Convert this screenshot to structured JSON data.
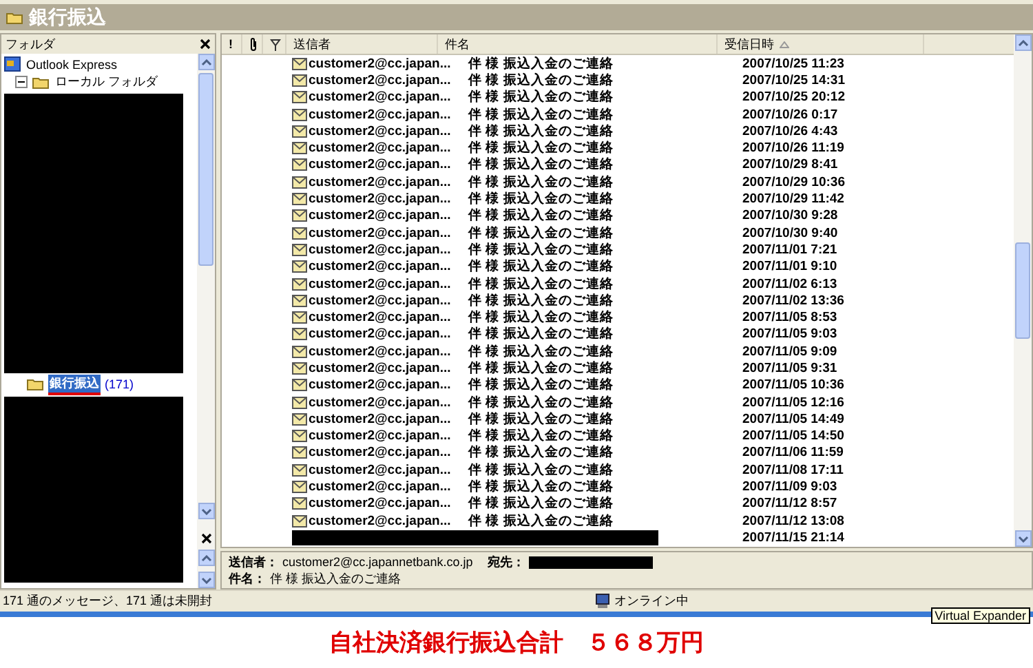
{
  "window": {
    "title": "銀行振込"
  },
  "folder_pane": {
    "title": "フォルダ",
    "tree": [
      {
        "kind": "folder",
        "label": "Outlook Express",
        "selected": false,
        "children": [
          {
            "kind": "folder",
            "label": "ローカル フォルダ",
            "selected": false,
            "expanded": true,
            "children": [
              {
                "kind": "redacted"
              },
              {
                "kind": "folder",
                "label": "銀行振込",
                "count": "(171)",
                "selected": true
              },
              {
                "kind": "redacted"
              }
            ]
          }
        ]
      }
    ]
  },
  "message_list": {
    "columns": [
      {
        "kind": "icon",
        "label": "!"
      },
      {
        "kind": "attach"
      },
      {
        "kind": "flag"
      },
      {
        "kind": "text",
        "label": "送信者"
      },
      {
        "kind": "text",
        "label": "件名"
      },
      {
        "kind": "sort",
        "label": "受信日時"
      }
    ],
    "rows": [
      {
        "kind": "message",
        "sender": "customer2@cc.japan...",
        "subject": "伴 様 振込入金のご連絡",
        "received": "2007/10/25 11:23"
      },
      {
        "kind": "message",
        "sender": "customer2@cc.japan...",
        "subject": "伴 様 振込入金のご連絡",
        "received": "2007/10/25 14:31"
      },
      {
        "kind": "message",
        "sender": "customer2@cc.japan...",
        "subject": "伴 様 振込入金のご連絡",
        "received": "2007/10/25 20:12"
      },
      {
        "kind": "message",
        "sender": "customer2@cc.japan...",
        "subject": "伴 様 振込入金のご連絡",
        "received": "2007/10/26 0:17"
      },
      {
        "kind": "message",
        "sender": "customer2@cc.japan...",
        "subject": "伴 様 振込入金のご連絡",
        "received": "2007/10/26 4:43"
      },
      {
        "kind": "message",
        "sender": "customer2@cc.japan...",
        "subject": "伴 様 振込入金のご連絡",
        "received": "2007/10/26 11:19"
      },
      {
        "kind": "message",
        "sender": "customer2@cc.japan...",
        "subject": "伴 様 振込入金のご連絡",
        "received": "2007/10/29 8:41"
      },
      {
        "kind": "message",
        "sender": "customer2@cc.japan...",
        "subject": "伴 様 振込入金のご連絡",
        "received": "2007/10/29 10:36"
      },
      {
        "kind": "message",
        "sender": "customer2@cc.japan...",
        "subject": "伴 様 振込入金のご連絡",
        "received": "2007/10/29 11:42"
      },
      {
        "kind": "message",
        "sender": "customer2@cc.japan...",
        "subject": "伴 様 振込入金のご連絡",
        "received": "2007/10/30 9:28"
      },
      {
        "kind": "message",
        "sender": "customer2@cc.japan...",
        "subject": "伴 様 振込入金のご連絡",
        "received": "2007/10/30 9:40"
      },
      {
        "kind": "message",
        "sender": "customer2@cc.japan...",
        "subject": "伴 様 振込入金のご連絡",
        "received": "2007/11/01 7:21"
      },
      {
        "kind": "message",
        "sender": "customer2@cc.japan...",
        "subject": "伴 様 振込入金のご連絡",
        "received": "2007/11/01 9:10"
      },
      {
        "kind": "message",
        "sender": "customer2@cc.japan...",
        "subject": "伴 様 振込入金のご連絡",
        "received": "2007/11/02 6:13"
      },
      {
        "kind": "message",
        "sender": "customer2@cc.japan...",
        "subject": "伴 様 振込入金のご連絡",
        "received": "2007/11/02 13:36"
      },
      {
        "kind": "message",
        "sender": "customer2@cc.japan...",
        "subject": "伴 様 振込入金のご連絡",
        "received": "2007/11/05 8:53"
      },
      {
        "kind": "message",
        "sender": "customer2@cc.japan...",
        "subject": "伴 様 振込入金のご連絡",
        "received": "2007/11/05 9:03"
      },
      {
        "kind": "message",
        "sender": "customer2@cc.japan...",
        "subject": "伴 様 振込入金のご連絡",
        "received": "2007/11/05 9:09"
      },
      {
        "kind": "message",
        "sender": "customer2@cc.japan...",
        "subject": "伴 様 振込入金のご連絡",
        "received": "2007/11/05 9:31"
      },
      {
        "kind": "message",
        "sender": "customer2@cc.japan...",
        "subject": "伴 様 振込入金のご連絡",
        "received": "2007/11/05 10:36"
      },
      {
        "kind": "message",
        "sender": "customer2@cc.japan...",
        "subject": "伴 様 振込入金のご連絡",
        "received": "2007/11/05 12:16"
      },
      {
        "kind": "message",
        "sender": "customer2@cc.japan...",
        "subject": "伴 様 振込入金のご連絡",
        "received": "2007/11/05 14:49"
      },
      {
        "kind": "message",
        "sender": "customer2@cc.japan...",
        "subject": "伴 様 振込入金のご連絡",
        "received": "2007/11/05 14:50"
      },
      {
        "kind": "message",
        "sender": "customer2@cc.japan...",
        "subject": "伴 様 振込入金のご連絡",
        "received": "2007/11/06 11:59"
      },
      {
        "kind": "message",
        "sender": "customer2@cc.japan...",
        "subject": "伴 様 振込入金のご連絡",
        "received": "2007/11/08 17:11"
      },
      {
        "kind": "message",
        "sender": "customer2@cc.japan...",
        "subject": "伴 様 振込入金のご連絡",
        "received": "2007/11/09 9:03"
      },
      {
        "kind": "message",
        "sender": "customer2@cc.japan...",
        "subject": "伴 様 振込入金のご連絡",
        "received": "2007/11/12 8:57"
      },
      {
        "kind": "message",
        "sender": "customer2@cc.japan...",
        "subject": "伴 様 振込入金のご連絡",
        "received": "2007/11/12 13:08"
      },
      {
        "kind": "redacted",
        "received": "2007/11/15 21:14"
      }
    ]
  },
  "preview_header": {
    "from_label": "送信者：",
    "from": "customer2@cc.japannetbank.co.jp",
    "to_label": "宛先：",
    "subject_label": "件名：",
    "subject": "伴 様 振込入金のご連絡"
  },
  "status_bar": {
    "message": "171 通のメッセージ、171 通は未開封",
    "connection": "オンライン中"
  },
  "tooltip": "Virtual Expander",
  "caption": "自社決済銀行振込合計　５６８万円"
}
